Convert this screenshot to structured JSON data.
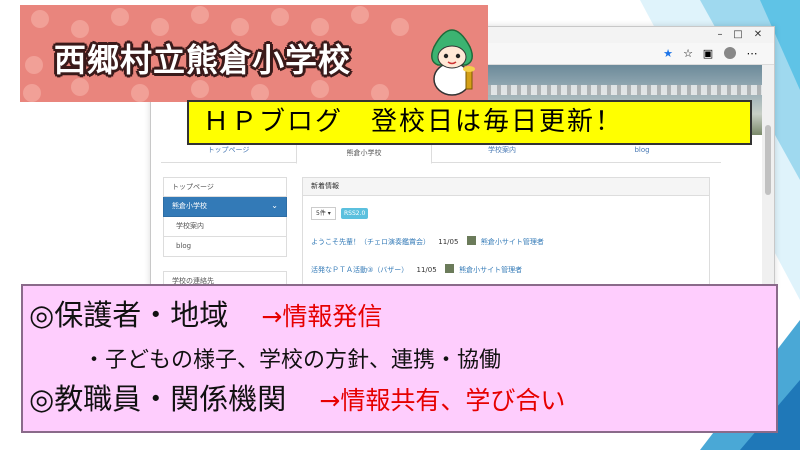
{
  "banner": {
    "title": "西郷村立熊倉小学校"
  },
  "callout": {
    "text": "ＨＰブログ　登校日は毎日更新！"
  },
  "browser": {
    "nav_tabs": [
      {
        "label": "トップページ",
        "active": false
      },
      {
        "label": "熊倉小学校",
        "active": true
      },
      {
        "label": "学校案内",
        "active": false
      },
      {
        "label": "blog",
        "active": false
      }
    ],
    "side_menu": [
      {
        "label": "トップページ",
        "active": false
      },
      {
        "label": "熊倉小学校",
        "active": true
      },
      {
        "label": "学校案内",
        "active": false
      },
      {
        "label": "blog",
        "active": false
      }
    ],
    "side_heading": "学校の連絡先",
    "panel": {
      "heading": "新着情報",
      "count_label": "5件 ▾",
      "rss_label": "RSS2.0",
      "news": [
        {
          "title": "ようこそ先輩！（チェロ演奏鑑賞会）",
          "date": "11/05",
          "author": "熊倉小サイト管理者"
        },
        {
          "title": "活発なＰＴＡ活動③（バザー）",
          "date": "11/05",
          "author": "熊倉小サイト管理者"
        }
      ]
    }
  },
  "info": {
    "line1_main": "◎保護者・地域",
    "line1_note": "→情報発信",
    "line2": "・子どもの様子、学校の方針、連携・協働",
    "line3_main": "◎教職員・関係機関",
    "line3_note": "→情報共有、学び合い"
  },
  "colors": {
    "banner_bg": "#e9857d",
    "callout_bg": "#ffff00",
    "info_bg": "#fecdfd",
    "accent_red": "#e60000",
    "link_blue": "#337ab7"
  }
}
